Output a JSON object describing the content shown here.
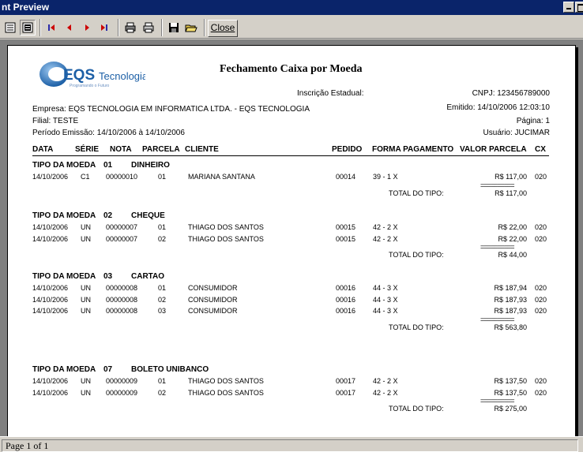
{
  "window": {
    "title": "nt Preview"
  },
  "toolbar": {
    "close_label": "Close"
  },
  "report": {
    "company_logo": "EQS Tecnologia",
    "title": "Fechamento Caixa por Moeda",
    "inscricao_label": "Inscrição Estadual:",
    "cnpj": "CNPJ: 123456789000",
    "empresa": "Empresa:  EQS TECNOLOGIA EM INFORMATICA LTDA. - EQS TECNOLOGIA",
    "emitido": "Emitido: 14/10/2006 12:03:10",
    "filial": "Filial:    TESTE",
    "pagina": "Página: 1",
    "periodo": "Período Emissão: 14/10/2006 à 14/10/2006",
    "usuario": "Usuário:  JUCIMAR",
    "columns": {
      "data": "DATA",
      "serie": "SÉRIE",
      "nota": "NOTA",
      "parcela": "PARCELA",
      "cliente": "CLIENTE",
      "pedido": "PEDIDO",
      "forma": "FORMA PAGAMENTO",
      "valor": "VALOR PARCELA",
      "cx": "CX"
    },
    "total_label": "TOTAL DO TIPO:",
    "double_rule": "==========",
    "groups": [
      {
        "label": "TIPO DA MOEDA",
        "code": "01",
        "name": "DINHEIRO",
        "total": "R$ 117,00",
        "rows": [
          {
            "data": "14/10/2006",
            "serie": "C1",
            "nota": "00000010",
            "parcela": "01",
            "cliente": "MARIANA SANTANA",
            "pedido": "00014",
            "forma": "39 - 1 X",
            "valor": "R$ 117,00",
            "cx": "020"
          }
        ]
      },
      {
        "label": "TIPO DA MOEDA",
        "code": "02",
        "name": "CHEQUE",
        "total": "R$ 44,00",
        "rows": [
          {
            "data": "14/10/2006",
            "serie": "UN",
            "nota": "00000007",
            "parcela": "01",
            "cliente": "THIAGO DOS SANTOS",
            "pedido": "00015",
            "forma": "42 - 2 X",
            "valor": "R$ 22,00",
            "cx": "020"
          },
          {
            "data": "14/10/2006",
            "serie": "UN",
            "nota": "00000007",
            "parcela": "02",
            "cliente": "THIAGO DOS SANTOS",
            "pedido": "00015",
            "forma": "42 - 2 X",
            "valor": "R$ 22,00",
            "cx": "020"
          }
        ]
      },
      {
        "label": "TIPO DA MOEDA",
        "code": "03",
        "name": "CARTAO",
        "total": "R$ 563,80",
        "rows": [
          {
            "data": "14/10/2006",
            "serie": "UN",
            "nota": "00000008",
            "parcela": "01",
            "cliente": "CONSUMIDOR",
            "pedido": "00016",
            "forma": "44 - 3 X",
            "valor": "R$ 187,94",
            "cx": "020"
          },
          {
            "data": "14/10/2006",
            "serie": "UN",
            "nota": "00000008",
            "parcela": "02",
            "cliente": "CONSUMIDOR",
            "pedido": "00016",
            "forma": "44 - 3 X",
            "valor": "R$ 187,93",
            "cx": "020"
          },
          {
            "data": "14/10/2006",
            "serie": "UN",
            "nota": "00000008",
            "parcela": "03",
            "cliente": "CONSUMIDOR",
            "pedido": "00016",
            "forma": "44 - 3 X",
            "valor": "R$ 187,93",
            "cx": "020"
          }
        ]
      },
      {
        "label": "TIPO DA MOEDA",
        "code": "07",
        "name": "BOLETO UNIBANCO",
        "total": "R$ 275,00",
        "rows": [
          {
            "data": "14/10/2006",
            "serie": "UN",
            "nota": "00000009",
            "parcela": "01",
            "cliente": "THIAGO DOS SANTOS",
            "pedido": "00017",
            "forma": "42 - 2 X",
            "valor": "R$ 137,50",
            "cx": "020"
          },
          {
            "data": "14/10/2006",
            "serie": "UN",
            "nota": "00000009",
            "parcela": "02",
            "cliente": "THIAGO DOS SANTOS",
            "pedido": "00017",
            "forma": "42 - 2 X",
            "valor": "R$ 137,50",
            "cx": "020"
          }
        ]
      }
    ]
  },
  "status": {
    "page_text": "Page 1 of 1"
  },
  "colors": {
    "titlebar": "#0a246a",
    "nav_arrow": "#cc0000",
    "logo_blue": "#1c5fa6"
  }
}
